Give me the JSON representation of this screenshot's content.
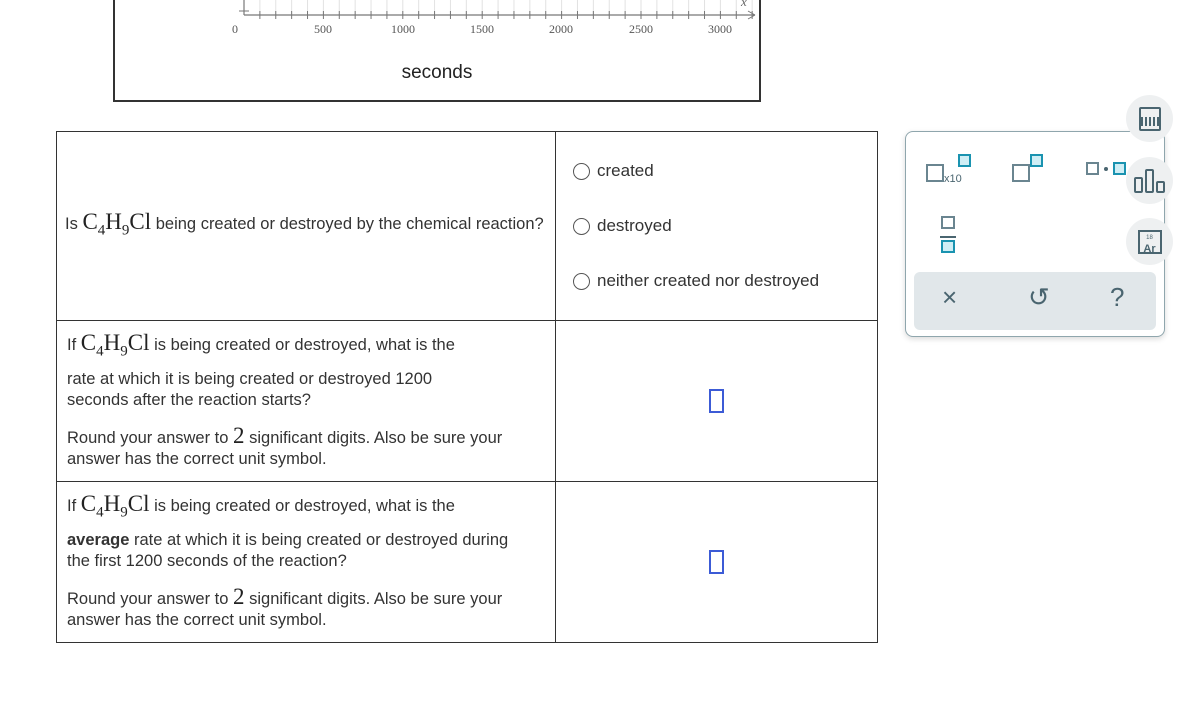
{
  "graph": {
    "x_ticks": [
      "0",
      "500",
      "1000",
      "1500",
      "2000",
      "2500",
      "3000"
    ],
    "x_axis_var": "x",
    "x_label": "seconds"
  },
  "questions": [
    {
      "pre": "Is",
      "chem": {
        "C": "C",
        "n1": "4",
        "H": "H",
        "n2": "9",
        "Cl": "Cl"
      },
      "text": "being created or destroyed by the chemical reaction?",
      "options": [
        "created",
        "destroyed",
        "neither created nor destroyed"
      ]
    },
    {
      "pre": "If",
      "text1": "is being created or destroyed, what is the",
      "text2": "rate at which it is being created or destroyed 1200 seconds after the reaction starts?",
      "round_pre": "Round your answer to",
      "digits": "2",
      "round_post": "significant digits. Also be sure your answer has the correct unit symbol."
    },
    {
      "pre": "If",
      "text1": "is being created or destroyed, what is the",
      "bold": "average",
      "text2": "rate at which it is being created or destroyed during the first 1200 seconds of the reaction?",
      "round_pre": "Round your answer to",
      "digits": "2",
      "round_post": "significant digits. Also be sure your answer has the correct unit symbol."
    }
  ],
  "palette": {
    "x10_label": "x10",
    "clear": "×",
    "undo": "↺",
    "help": "?"
  },
  "sidebar": {
    "periodic_number": "18",
    "periodic_symbol": "Ar"
  }
}
